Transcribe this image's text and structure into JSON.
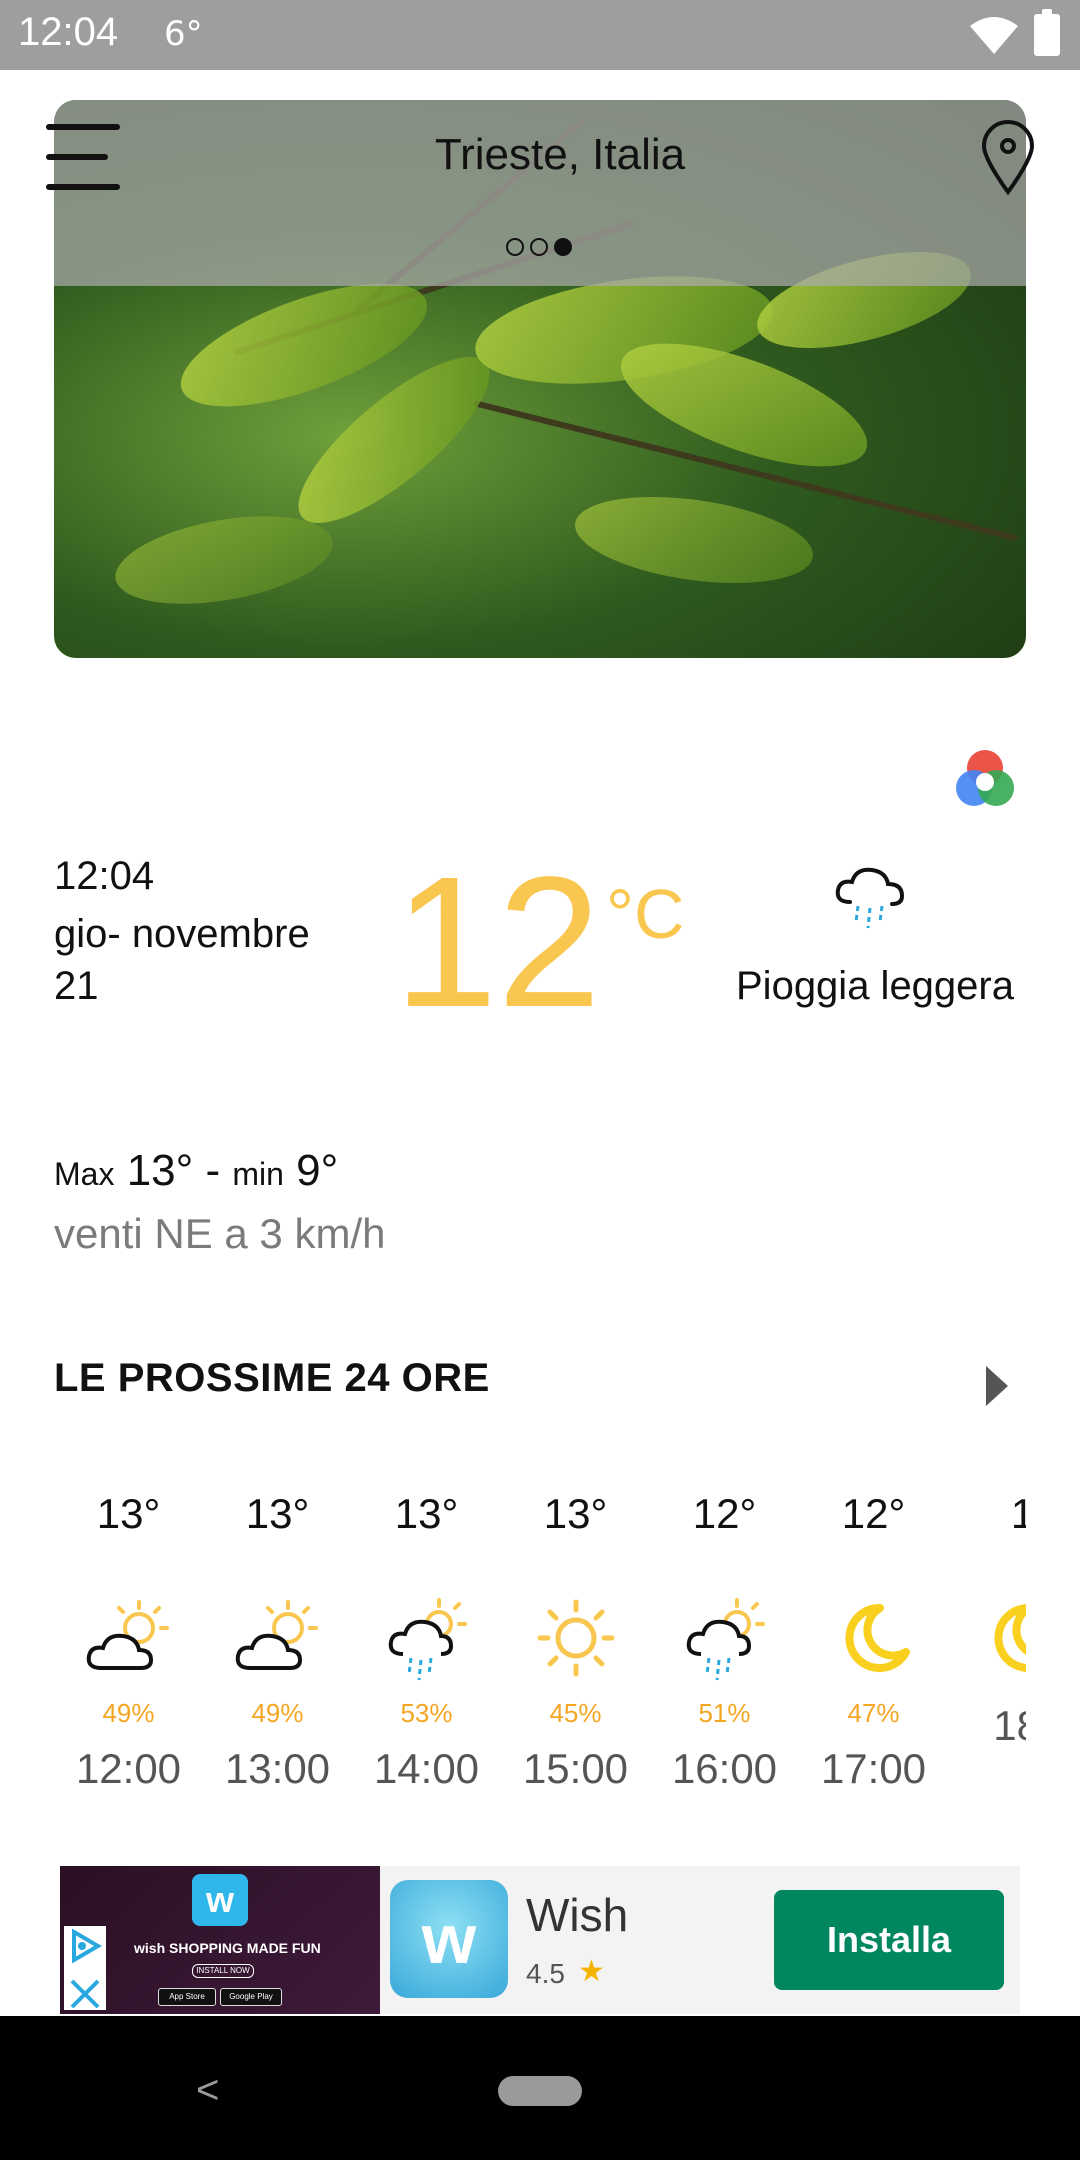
{
  "status_bar": {
    "time": "12:04",
    "indicator": "6°"
  },
  "header": {
    "city": "Trieste, Italia",
    "page_dots": 3,
    "active_dot": 3
  },
  "current": {
    "time": "12:04",
    "date_line1": "gio- novembre",
    "date_line2": "21",
    "temperature": "12",
    "unit": "°C",
    "condition": "Pioggia leggera",
    "max_label": "Max",
    "max_value": "13°",
    "separator": "-",
    "min_label": "min",
    "min_value": "9°",
    "wind": "venti NE a 3 km/h"
  },
  "section": {
    "title": "LE PROSSIME 24 ORE"
  },
  "hourly": [
    {
      "temp": "13°",
      "icon": "partly-cloudy-sun-icon",
      "pct": "49%",
      "hour": "12:00"
    },
    {
      "temp": "13°",
      "icon": "partly-cloudy-sun-icon",
      "pct": "49%",
      "hour": "13:00"
    },
    {
      "temp": "13°",
      "icon": "rain-sun-icon",
      "pct": "53%",
      "hour": "14:00"
    },
    {
      "temp": "13°",
      "icon": "sun-icon",
      "pct": "45%",
      "hour": "15:00"
    },
    {
      "temp": "12°",
      "icon": "rain-sun-icon",
      "pct": "51%",
      "hour": "16:00"
    },
    {
      "temp": "12°",
      "icon": "moon-icon",
      "pct": "47%",
      "hour": "17:00"
    },
    {
      "temp": "1",
      "icon": "moon-icon",
      "pct": "",
      "hour": "18:"
    }
  ],
  "ad": {
    "app_name": "Wish",
    "rating": "4.5",
    "install_label": "Installa",
    "promo_logo": "w",
    "promo_text": "wish SHOPPING MADE FUN",
    "promo_sub": "INSTALL NOW",
    "store1": "App Store",
    "store2": "Google Play"
  },
  "colors": {
    "accent_yellow": "#f9c74f",
    "percent_orange": "#f5a623",
    "install_green": "#01875f",
    "rain_blue": "#29a8e0"
  }
}
